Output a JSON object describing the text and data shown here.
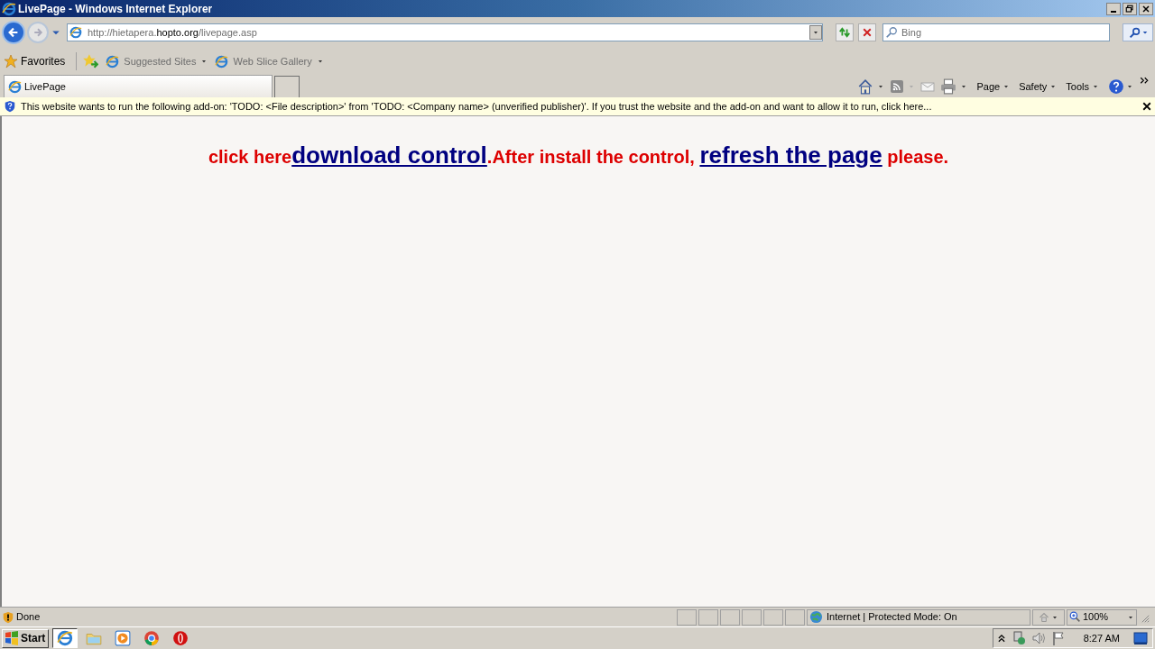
{
  "window": {
    "title": "LivePage - Windows Internet Explorer"
  },
  "address_bar": {
    "url_parts": [
      {
        "text": "http://hietapera.",
        "kind": "dim"
      },
      {
        "text": "hopto.org",
        "kind": "domain"
      },
      {
        "text": "/livepage.asp",
        "kind": "dim"
      }
    ]
  },
  "search": {
    "placeholder": "Bing"
  },
  "favorites_bar": {
    "items": [
      {
        "label": "Favorites",
        "kind": "favorites"
      },
      {
        "label": "Suggested Sites",
        "kind": "link"
      },
      {
        "label": "Web Slice Gallery",
        "kind": "link"
      }
    ]
  },
  "tabs": [
    {
      "label": "LivePage",
      "selected": true
    }
  ],
  "command_bar": {
    "menus": [
      "Page",
      "Safety",
      "Tools"
    ]
  },
  "info_bar": {
    "message": "This website wants to run the following add-on: 'TODO: <File description>' from 'TODO: <Company name> (unverified publisher)'. If you trust the website and the add-on and want to allow it to run, click here..."
  },
  "content": {
    "segments": [
      {
        "text": "click here",
        "kind": "plain"
      },
      {
        "text": "download control",
        "kind": "link"
      },
      {
        "text": ".After install the control, ",
        "kind": "plain"
      },
      {
        "text": "refresh the page",
        "kind": "link"
      },
      {
        "text": " please.",
        "kind": "plain"
      }
    ]
  },
  "status_bar": {
    "text": "Done",
    "zone": "Internet | Protected Mode: On",
    "zoom": "100%"
  },
  "taskbar": {
    "start": "Start",
    "apps": [
      {
        "kind": "ie",
        "selected": true
      },
      {
        "kind": "folder",
        "selected": false
      },
      {
        "kind": "media",
        "selected": false
      },
      {
        "kind": "chrome",
        "selected": false
      },
      {
        "kind": "opera",
        "selected": false
      }
    ],
    "clock": "8:27 AM"
  }
}
